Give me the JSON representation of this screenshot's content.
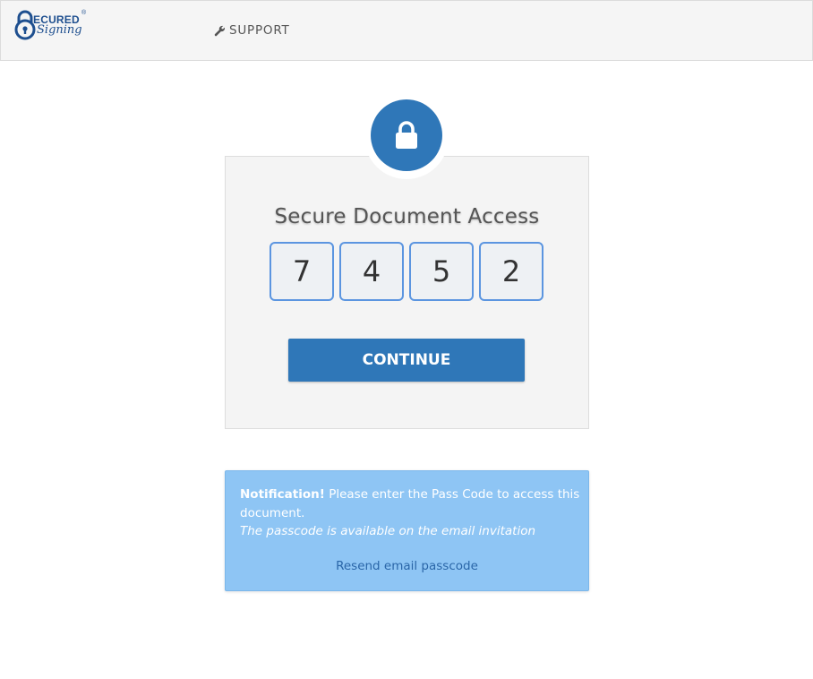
{
  "header": {
    "logo": {
      "line1": "ECURED",
      "line2": "Signing",
      "reg": "®"
    },
    "support_label": "SUPPORT"
  },
  "card": {
    "title": "Secure Document Access",
    "passcode_digits": [
      "7",
      "4",
      "5",
      "2"
    ],
    "continue_label": "CONTINUE"
  },
  "notification": {
    "strong": "Notification!",
    "message": " Please enter the Pass Code to access this document.",
    "hint": "The passcode is available on the email invitation",
    "resend_label": "Resend email passcode"
  },
  "colors": {
    "brand_blue": "#2f77b8",
    "notification_bg": "#8ec5f4",
    "code_border": "#5b95e0",
    "link": "#2a66a8"
  },
  "icons": {
    "logo": "secured-signing-logo",
    "support": "wrench-icon",
    "badge": "lock-icon"
  }
}
